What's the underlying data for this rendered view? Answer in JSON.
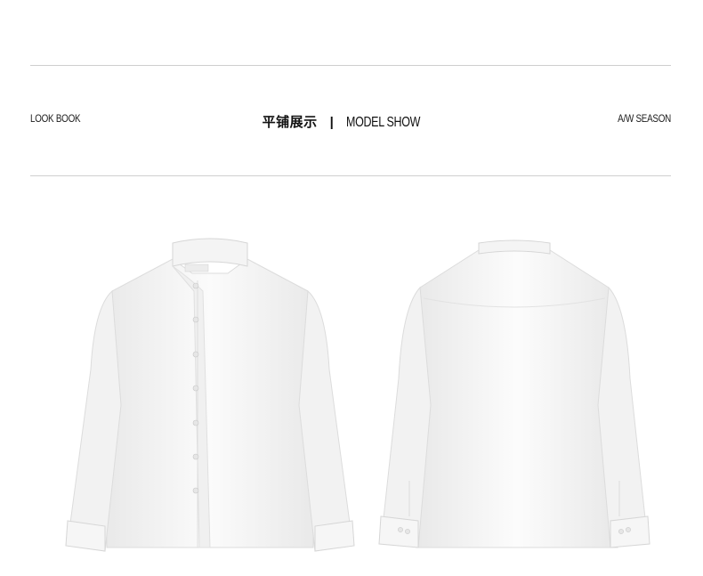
{
  "header": {
    "left_label": "LOOK BOOK",
    "title_cn": "平铺展示",
    "separator": "|",
    "title_en": "MODEL SHOW",
    "right_label": "A/W SEASON"
  },
  "products": [
    {
      "view": "front",
      "icon": "white-shirt-front-icon"
    },
    {
      "view": "back",
      "icon": "white-shirt-back-icon"
    }
  ],
  "colors": {
    "rule": "#cfcfcf",
    "text": "#1a1a1a",
    "shirt": "#f7f7f7",
    "shirt_shadow": "#e2e2e2"
  }
}
